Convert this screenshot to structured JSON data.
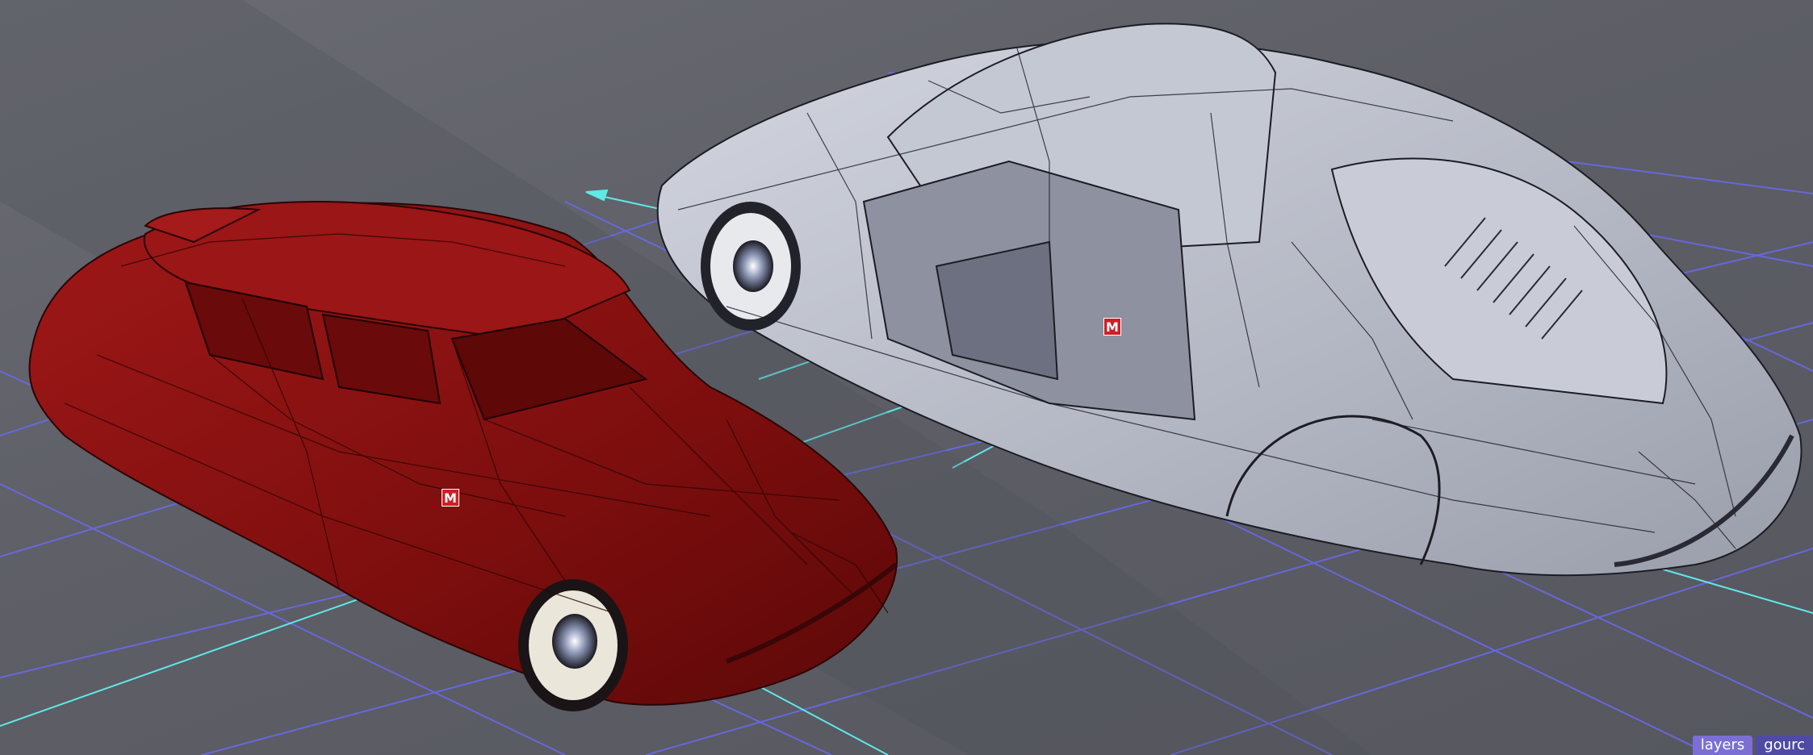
{
  "viewport": {
    "background": "#5f6068",
    "grid_color": "#6a6af0",
    "axis_color": "#5fe8e8"
  },
  "objects": [
    {
      "name": "red-car",
      "color": "#8e1212",
      "marker_label": "M"
    },
    {
      "name": "wireframe-car",
      "color": "#b9bdc9",
      "marker_label": "M"
    }
  ],
  "statusbar": {
    "tabs": [
      {
        "label": "layers",
        "active": true
      },
      {
        "label": "gourc",
        "active": false
      }
    ]
  }
}
